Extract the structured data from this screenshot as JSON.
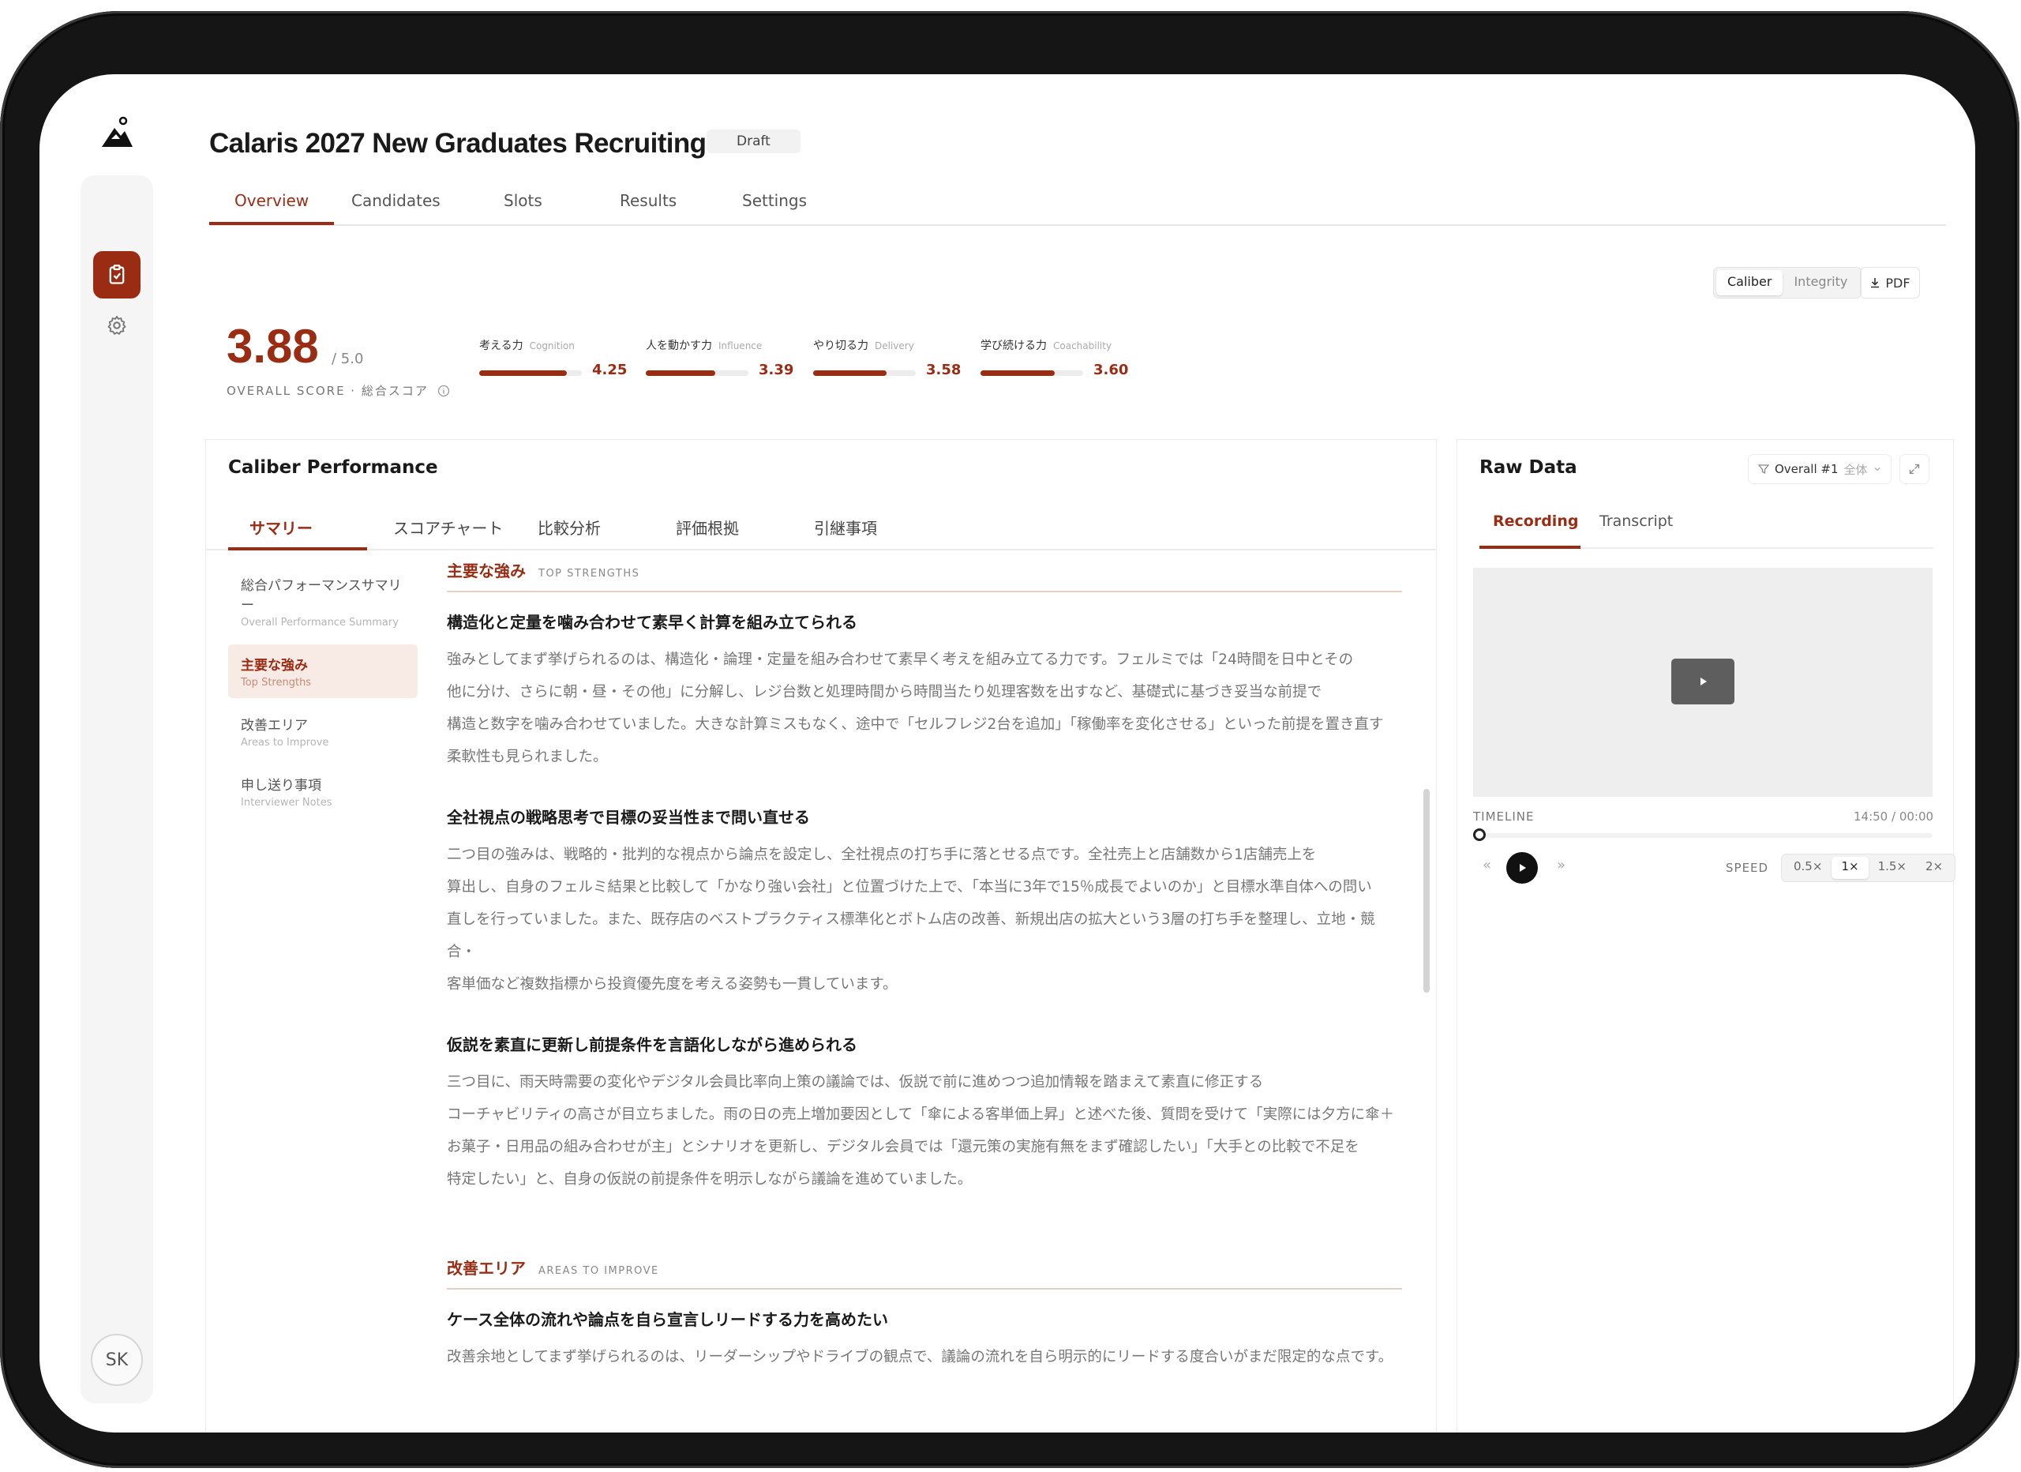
{
  "app": {
    "title": "Calaris 2027 New Graduates Recruiting",
    "status": "Draft",
    "user_initials": "SK"
  },
  "nav_tabs": [
    {
      "label": "Overview",
      "active": true
    },
    {
      "label": "Candidates",
      "active": false
    },
    {
      "label": "Slots",
      "active": false
    },
    {
      "label": "Results",
      "active": false
    },
    {
      "label": "Settings",
      "active": false
    }
  ],
  "mode_switch": {
    "options": [
      "Caliber",
      "Integrity"
    ],
    "selected": "Caliber"
  },
  "pdf_button": "PDF",
  "score": {
    "overall": "3.88",
    "max": "/ 5.0",
    "label": "OVERALL SCORE · 総合スコア"
  },
  "metrics": [
    {
      "label": "考える力",
      "en": "Cognition",
      "value": "4.25",
      "fraction": 0.85
    },
    {
      "label": "人を動かす力",
      "en": "Influence",
      "value": "3.39",
      "fraction": 0.678
    },
    {
      "label": "やり切る力",
      "en": "Delivery",
      "value": "3.58",
      "fraction": 0.716
    },
    {
      "label": "学び続ける力",
      "en": "Coachability",
      "value": "3.60",
      "fraction": 0.72
    }
  ],
  "caliber": {
    "title": "Caliber Performance",
    "tabs": [
      {
        "label": "サマリー",
        "active": true
      },
      {
        "label": "スコアチャート",
        "active": false
      },
      {
        "label": "比較分析",
        "active": false
      },
      {
        "label": "評価根拠",
        "active": false
      },
      {
        "label": "引継事項",
        "active": false
      }
    ],
    "nav": [
      {
        "jp": "総合パフォーマンスサマリー",
        "en": "Overall Performance Summary",
        "active": false
      },
      {
        "jp": "主要な強み",
        "en": "Top Strengths",
        "active": true
      },
      {
        "jp": "改善エリア",
        "en": "Areas to Improve",
        "active": false
      },
      {
        "jp": "申し送り事項",
        "en": "Interviewer Notes",
        "active": false
      }
    ],
    "sections": [
      {
        "jp": "主要な強み",
        "en": "TOP STRENGTHS",
        "items": [
          {
            "title": "構造化と定量を噛み合わせて素早く計算を組み立てられる",
            "body": "強みとしてまず挙げられるのは、構造化・論理・定量を組み合わせて素早く考えを組み立てる力です。フェルミでは「24時間を日中とその\n他に分け、さらに朝・昼・その他」に分解し、レジ台数と処理時間から時間当たり処理客数を出すなど、基礎式に基づき妥当な前提で\n構造と数字を噛み合わせていました。大きな計算ミスもなく、途中で「セルフレジ2台を追加」「稼働率を変化させる」といった前提を置き直す\n柔軟性も見られました。"
          },
          {
            "title": "全社視点の戦略思考で目標の妥当性まで問い直せる",
            "body": "二つ目の強みは、戦略的・批判的な視点から論点を設定し、全社視点の打ち手に落とせる点です。全社売上と店舗数から1店舗売上を\n算出し、自身のフェルミ結果と比較して「かなり強い会社」と位置づけた上で、「本当に3年で15％成長でよいのか」と目標水準自体への問い\n直しを行っていました。また、既存店のベストプラクティス標準化とボトム店の改善、新規出店の拡大という3層の打ち手を整理し、立地・競合・\n客単価など複数指標から投資優先度を考える姿勢も一貫しています。"
          },
          {
            "title": "仮説を素直に更新し前提条件を言語化しながら進められる",
            "body": "三つ目に、雨天時需要の変化やデジタル会員比率向上策の議論では、仮説で前に進めつつ追加情報を踏まえて素直に修正する\nコーチャビリティの高さが目立ちました。雨の日の売上増加要因として「傘による客単価上昇」と述べた後、質問を受けて「実際には夕方に傘＋\nお菓子・日用品の組み合わせが主」とシナリオを更新し、デジタル会員では「還元策の実施有無をまず確認したい」「大手との比較で不足を\n特定したい」と、自身の仮説の前提条件を明示しながら議論を進めていました。"
          }
        ]
      },
      {
        "jp": "改善エリア",
        "en": "AREAS TO IMPROVE",
        "items": [
          {
            "title": "ケース全体の流れや論点を自ら宣言しリードする力を高めたい",
            "body": "改善余地としてまず挙げられるのは、リーダーシップやドライブの観点で、議論の流れを自ら明示的にリードする度合いがまだ限定的な点です。"
          }
        ]
      }
    ]
  },
  "raw_data": {
    "title": "Raw Data",
    "filter_label": "Overall #1",
    "filter_sub": "全体",
    "tabs": [
      {
        "label": "Recording",
        "active": true
      },
      {
        "label": "Transcript",
        "active": false
      }
    ],
    "timeline_label": "TIMELINE",
    "timeline_time": "14:50 / 00:00",
    "speed_label": "SPEED",
    "speeds": [
      "0.5×",
      "1×",
      "1.5×",
      "2×"
    ],
    "speed_selected": "1×"
  },
  "colors": {
    "accent": "#9a2c14",
    "accent_soft": "#f8ebe6"
  }
}
